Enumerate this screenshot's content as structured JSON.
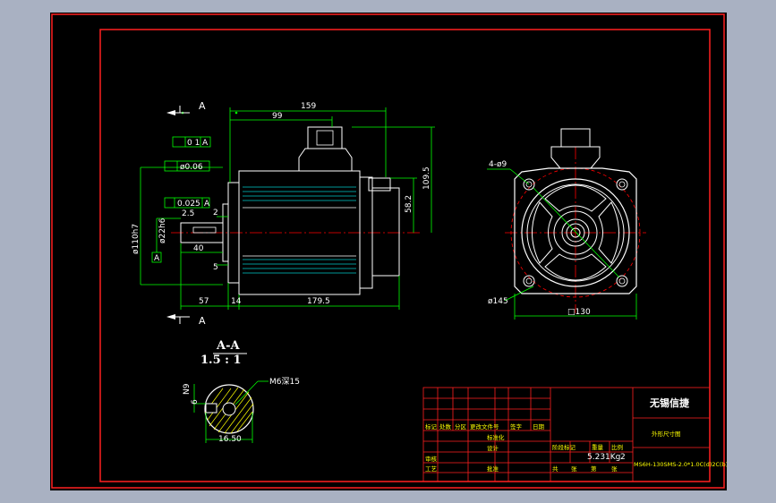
{
  "colors": {
    "background": "#a9b1c2",
    "canvas": "#000000",
    "border_red": "#ff2020",
    "outline_white": "#ffffff",
    "dimension_green": "#00ff00",
    "centerline_red": "#ff0000",
    "view_cyan": "#00c8c8",
    "hatch_yellow": "#ffff00"
  },
  "section_marker": {
    "letter": "A"
  },
  "section_view": {
    "title": "A-A",
    "scale": "1.5 : 1",
    "thread_label": "M6深15",
    "dim_n": "N9",
    "dim_6": "6",
    "dim_width": "16.50"
  },
  "front_dims": {
    "d159": "159",
    "d99": "99",
    "d109_5": "109.5",
    "d58_2": "58.2",
    "d57": "57",
    "d14": "14",
    "d179_5": "179.5",
    "d40": "40",
    "d2": "2",
    "d5": "5",
    "d2_5": "2.5",
    "dia_shaft": "ø22h6",
    "dia_spigot": "ø110h7",
    "tol_perp": "0 1",
    "tol_circ": "ø0.06",
    "tol_runout": "0.025",
    "datum": "A"
  },
  "side_dims": {
    "holes": "4-ø9",
    "pcd": "ø145",
    "square": "□130"
  },
  "title_block": {
    "company": "无锡信捷",
    "drawing_name": "外形尺寸图",
    "weight": "5.231Kg",
    "scale": "2",
    "row_labels": [
      "标记",
      "处数",
      "分区",
      "更改文件号",
      "签字",
      "日期"
    ],
    "design_label": "设计",
    "standard_label": "标准化",
    "check_label": "审核",
    "process_label": "工艺",
    "approve_label": "批准",
    "stage_label": "阶段标记",
    "mass_label": "重量",
    "ratio_label": "比例",
    "sheet_total_label": "共",
    "sheet_label": "张",
    "sheet_num_label": "第",
    "sheet_num_suffix": "张",
    "model_code": "MS6H-130SMS-2.0*1.0C(d)2C(b)-2.0kW-3000"
  }
}
